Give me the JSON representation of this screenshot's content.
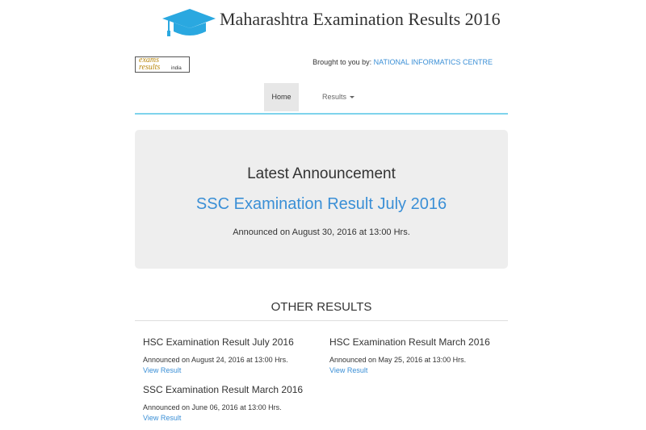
{
  "header": {
    "title": "Maharashtra Examination Results 2016",
    "icon": "graduation-cap-icon",
    "icon_color": "#2aa8e0"
  },
  "logo": {
    "line1": "exams",
    "line2": "results",
    "line3": "india"
  },
  "brought_by": {
    "prefix": "Brought to you by:",
    "org": "NATIONAL INFORMATICS CENTRE"
  },
  "nav": {
    "home": "Home",
    "results": "Results"
  },
  "announcement": {
    "heading": "Latest Announcement",
    "link": "SSC Examination Result July 2016",
    "date": "Announced on August 30, 2016 at 13:00 Hrs."
  },
  "other": {
    "title": "OTHER RESULTS",
    "items": [
      {
        "title": "HSC Examination Result July 2016",
        "date": "Announced on August 24, 2016 at 13:00 Hrs.",
        "link": "View Result"
      },
      {
        "title": "HSC Examination Result March 2016",
        "date": "Announced on May 25, 2016 at 13:00 Hrs.",
        "link": "View Result"
      },
      {
        "title": "SSC Examination Result March 2016",
        "date": "Announced on June 06, 2016 at 13:00 Hrs.",
        "link": "View Result"
      }
    ]
  },
  "colors": {
    "link": "#3a8fd6",
    "nav_border": "#7fd3ec",
    "panel": "#eeeeee"
  }
}
